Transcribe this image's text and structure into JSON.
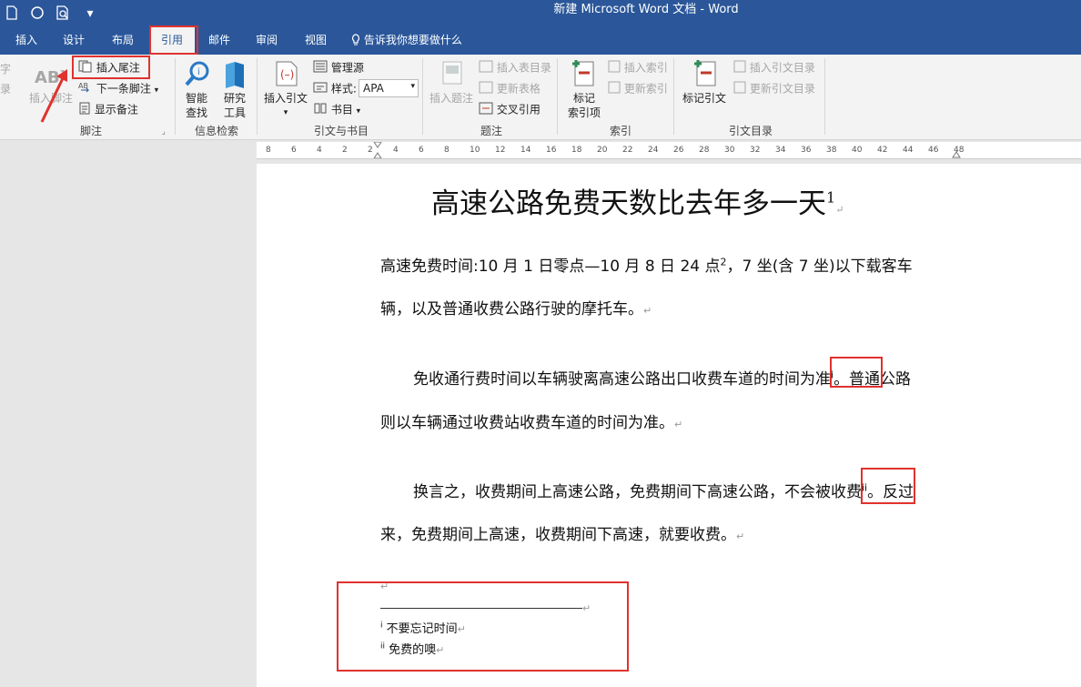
{
  "window": {
    "title": "新建 Microsoft Word 文档  -  Word"
  },
  "quick_access": {
    "icons": [
      "new-doc-icon",
      "circle-icon",
      "print-preview-icon",
      "customize-icon"
    ],
    "customize_glyph": "▾"
  },
  "tabs": [
    {
      "label": "插入"
    },
    {
      "label": "设计"
    },
    {
      "label": "布局"
    },
    {
      "label": "引用",
      "active": true
    },
    {
      "label": "邮件"
    },
    {
      "label": "审阅"
    },
    {
      "label": "视图"
    }
  ],
  "tell_me": "告诉我你想要做什么",
  "ribbon": {
    "left_cut": {
      "a": "字",
      "b": "录"
    },
    "footnotes": {
      "insert_footnote": "插入脚注",
      "insert_endnote": "插入尾注",
      "next_footnote": "下一条脚注",
      "show_notes": "显示备注",
      "group_label": "脚注",
      "ab_glyph": "AB",
      "sup1": "1"
    },
    "research": {
      "smart_lookup_1": "智能",
      "smart_lookup_2": "查找",
      "researcher_1": "研究",
      "researcher_2": "工具",
      "group_label": "信息检索"
    },
    "citations": {
      "insert_citation": "插入引文",
      "manage_sources": "管理源",
      "style_label": "样式:",
      "style_value": "APA",
      "bibliography": "书目",
      "group_label": "引文与书目"
    },
    "captions": {
      "insert_caption": "插入题注",
      "insert_table_of_figures": "插入表目录",
      "update_table": "更新表格",
      "cross_reference": "交叉引用",
      "group_label": "题注"
    },
    "index": {
      "mark_entry_1": "标记",
      "mark_entry_2": "索引项",
      "insert_index": "插入索引",
      "update_index": "更新索引",
      "group_label": "索引"
    },
    "toa": {
      "mark_citation": "标记引文",
      "insert_toa": "插入引文目录",
      "update_toa": "更新引文目录",
      "group_label": "引文目录"
    }
  },
  "ruler": {
    "ticks": [
      "8",
      "6",
      "4",
      "2",
      "2",
      "4",
      "6",
      "8",
      "10",
      "12",
      "14",
      "16",
      "18",
      "20",
      "22",
      "24",
      "26",
      "28",
      "30",
      "32",
      "34",
      "36",
      "38",
      "40",
      "42",
      "44",
      "46",
      "48"
    ]
  },
  "document": {
    "title": "高速公路免费天数比去年多一天",
    "title_sup": "1",
    "p1_line1": "高速免费时间:10 月 1 日零点—10 月 8 日 24 点",
    "p1_sup": "2",
    "p1_line1_tail": "，7 坐(含 7 坐)以下载客车",
    "p1_line2": "辆，以及普通收费公路行驶的摩托车。",
    "p2_line1_a": "免收通行费时间以车辆驶离高速公路出口收费车道的时间",
    "p2_boxed": "为准",
    "p2_sup": "i",
    "p2_line1_b": "。普通公路",
    "p2_line2": "则以车辆通过收费站收费车道的时间为准。",
    "p3_line1_a": "换言之，收费期间上高速公路，免费期间下高速公路，不会被",
    "p3_boxed": "收费",
    "p3_sup": "ii",
    "p3_line1_b": "。反过",
    "p3_line2": "来，免费期间上高速，收费期间下高速，就要收费。",
    "endnotes": [
      {
        "marker": "i",
        "text": "不要忘记时间"
      },
      {
        "marker": "ii",
        "text": "免费的噢"
      }
    ],
    "para_mark": "↵"
  },
  "colors": {
    "brand": "#2b579a",
    "highlight": "#e0322e",
    "ribbon_bg": "#f3f3f3"
  }
}
